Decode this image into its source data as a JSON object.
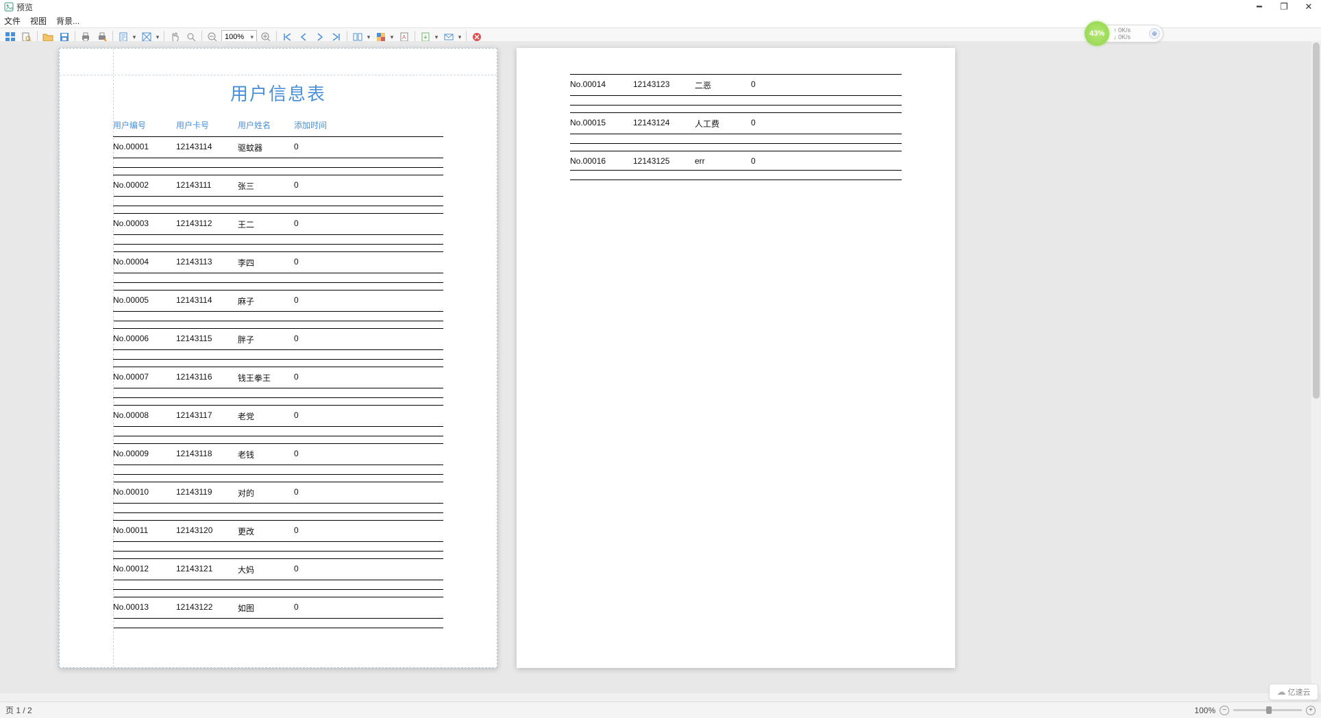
{
  "window": {
    "title": "预览"
  },
  "menu": {
    "file": "文件",
    "view": "视图",
    "background": "背景..."
  },
  "toolbar": {
    "zoom_value": "100%"
  },
  "network_widget": {
    "percent": "43%",
    "up": "0K/s",
    "down": "0K/s"
  },
  "report": {
    "title": "用户信息表",
    "headers": {
      "c1": "用户编号",
      "c2": "用户卡号",
      "c3": "用户姓名",
      "c4": "添加时间"
    },
    "page1_rows": [
      {
        "c1": "No.00001",
        "c2": "12143114",
        "c3": "驱蚊器",
        "c4": "0"
      },
      {
        "c1": "No.00002",
        "c2": "12143111",
        "c3": "张三",
        "c4": "0"
      },
      {
        "c1": "No.00003",
        "c2": "12143112",
        "c3": "王二",
        "c4": "0"
      },
      {
        "c1": "No.00004",
        "c2": "12143113",
        "c3": "李四",
        "c4": "0"
      },
      {
        "c1": "No.00005",
        "c2": "12143114",
        "c3": "麻子",
        "c4": "0"
      },
      {
        "c1": "No.00006",
        "c2": "12143115",
        "c3": "胖子",
        "c4": "0"
      },
      {
        "c1": "No.00007",
        "c2": "12143116",
        "c3": "钱王拳王",
        "c4": "0"
      },
      {
        "c1": "No.00008",
        "c2": "12143117",
        "c3": "老党",
        "c4": "0"
      },
      {
        "c1": "No.00009",
        "c2": "12143118",
        "c3": "老钱",
        "c4": "0"
      },
      {
        "c1": "No.00010",
        "c2": "12143119",
        "c3": "对的",
        "c4": "0"
      },
      {
        "c1": "No.00011",
        "c2": "12143120",
        "c3": "更改",
        "c4": "0"
      },
      {
        "c1": "No.00012",
        "c2": "12143121",
        "c3": "大妈",
        "c4": "0"
      },
      {
        "c1": "No.00013",
        "c2": "12143122",
        "c3": "如图",
        "c4": "0"
      }
    ],
    "page2_rows": [
      {
        "c1": "No.00014",
        "c2": "12143123",
        "c3": "二恶",
        "c4": "0"
      },
      {
        "c1": "No.00015",
        "c2": "12143124",
        "c3": "人工费",
        "c4": "0"
      },
      {
        "c1": "No.00016",
        "c2": "12143125",
        "c3": "err",
        "c4": "0"
      }
    ]
  },
  "status": {
    "page_label": "页 1 / 2",
    "zoom": "100%"
  },
  "watermark": "亿速云"
}
